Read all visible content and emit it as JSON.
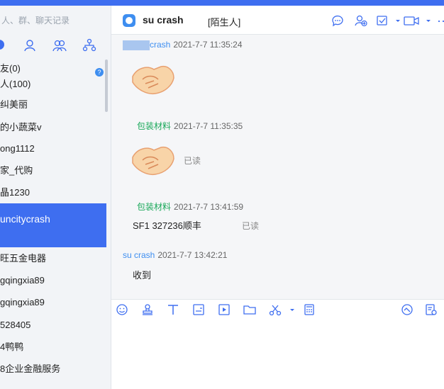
{
  "search": {
    "placeholder": "人、群、聊天记录"
  },
  "sidebar": {
    "items": [
      {
        "label": "友(0)"
      },
      {
        "label": "人(100)"
      },
      {
        "label": "纠美丽"
      },
      {
        "label": "的小蔬菜v"
      },
      {
        "label": "ong1112"
      },
      {
        "label": "家_代购"
      },
      {
        "label": "晶1230"
      },
      {
        "label": "uncitycrash"
      },
      {
        "label": "旺五金电器"
      },
      {
        "label": "gqingxia89"
      },
      {
        "label": "gqingxia89"
      },
      {
        "label": "528405"
      },
      {
        "label": "4鸭鸭"
      },
      {
        "label": "8企业金融服务"
      }
    ]
  },
  "chat": {
    "title": "su      crash",
    "stranger_label": "[陌生人]",
    "messages": [
      {
        "sender": "crash",
        "time": "2021-7-7 11:35:24"
      },
      {
        "sender": "包装材料",
        "time": "2021-7-7 11:35:35",
        "status": "已读"
      },
      {
        "sender": "包装材料",
        "time": "2021-7-7 13:41:59",
        "text": "SF1        327236顺丰",
        "status": "已读"
      },
      {
        "sender": "su      crash",
        "time": "2021-7-7 13:42:21",
        "text": "收到"
      }
    ]
  },
  "colors": {
    "accent": "#3e6ef0",
    "sender_blue": "#3e8ef0",
    "sender_green": "#1aa85a"
  }
}
